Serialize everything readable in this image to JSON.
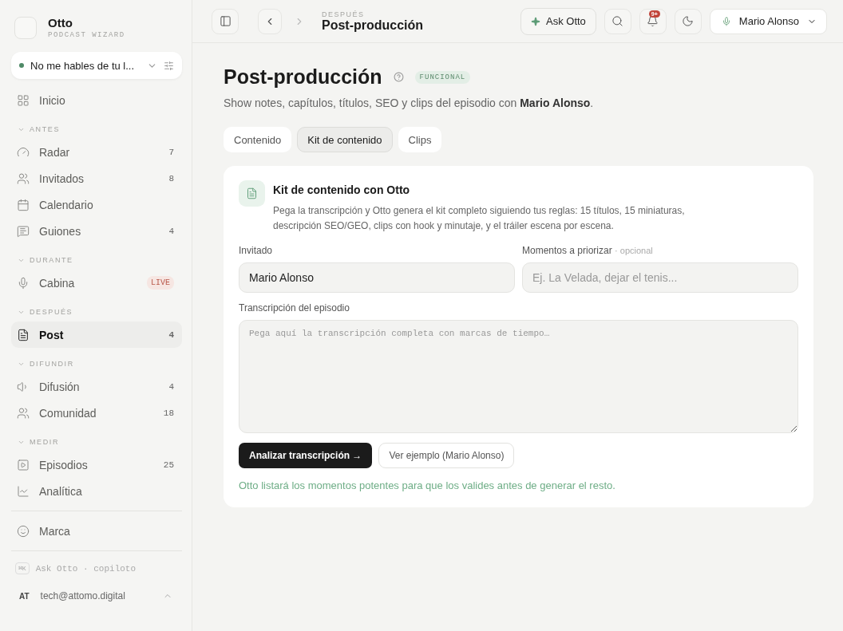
{
  "brand": {
    "name": "Otto",
    "subtitle": "PODCAST WIZARD"
  },
  "podcast_selector": {
    "label": "No me hables de tu l...",
    "online": true
  },
  "nav_top": [
    {
      "label": "Inicio",
      "selected": false
    }
  ],
  "nav_groups": [
    {
      "title": "ANTES",
      "expanded": true,
      "items": [
        {
          "label": "Radar",
          "count": "7",
          "selected": false
        },
        {
          "label": "Invitados",
          "count": "8",
          "selected": false
        },
        {
          "label": "Calendario",
          "selected": false
        },
        {
          "label": "Guiones",
          "count": "4",
          "selected": false
        }
      ]
    },
    {
      "title": "DURANTE",
      "expanded": true,
      "items": [
        {
          "label": "Cabina",
          "badge": "LIVE",
          "selected": false
        }
      ]
    },
    {
      "title": "DESPUÉS",
      "expanded": true,
      "items": [
        {
          "label": "Post",
          "count": "4",
          "selected": true
        }
      ]
    },
    {
      "title": "DIFUNDIR",
      "expanded": true,
      "items": [
        {
          "label": "Difusión",
          "count": "4",
          "selected": false
        },
        {
          "label": "Comunidad",
          "count": "18",
          "selected": false
        }
      ]
    },
    {
      "title": "MEDIR",
      "expanded": true,
      "items": [
        {
          "label": "Episodios",
          "count": "25",
          "selected": false
        },
        {
          "label": "Analítica",
          "selected": false
        }
      ]
    }
  ],
  "nav_bottom": [
    {
      "label": "Marca",
      "selected": false
    }
  ],
  "copilot": {
    "shortcut": "⌘K",
    "label": "Ask Otto · copiloto"
  },
  "user": {
    "initials": "AT",
    "email": "tech@attomo.digital"
  },
  "header": {
    "section": "DESPUÉS",
    "title": "Post-producción",
    "ask_button": "Ask Otto",
    "notifications": "9+",
    "guest_selector": "Mario Alonso"
  },
  "page": {
    "title": "Post-producción",
    "status": "FUNCIONAL",
    "subtitle": "Show notes, capítulos, títulos, SEO y clips del episodio con **Mario Alonso**."
  },
  "tabs": [
    {
      "label": "Contenido",
      "selected": false
    },
    {
      "label": "Kit de contenido",
      "selected": true
    },
    {
      "label": "Clips",
      "selected": false
    }
  ],
  "card": {
    "title": "Kit de contenido con Otto",
    "description": "Pega la transcripción y Otto genera el kit completo siguiendo tus reglas: 15 títulos, 15 miniaturas, descripción SEO/GEO, clips con hook y minutaje, y el tráiler escena por escena.",
    "guest_field": {
      "label": "Invitado",
      "value": "Mario Alonso"
    },
    "moments_field": {
      "label": "Momentos a priorizar",
      "note": "· opcional",
      "placeholder": "Ej. La Velada, dejar el tenis..."
    },
    "transcript_field": {
      "label": "Transcripción del episodio",
      "placeholder": "Pega aquí la transcripción completa con marcas de tiempo…"
    },
    "primary_button": "Analizar transcripción →",
    "secondary_button": "Ver ejemplo (Mario Alonso)",
    "hint": "Otto listará los momentos potentes para que los valides antes de generar el resto."
  }
}
